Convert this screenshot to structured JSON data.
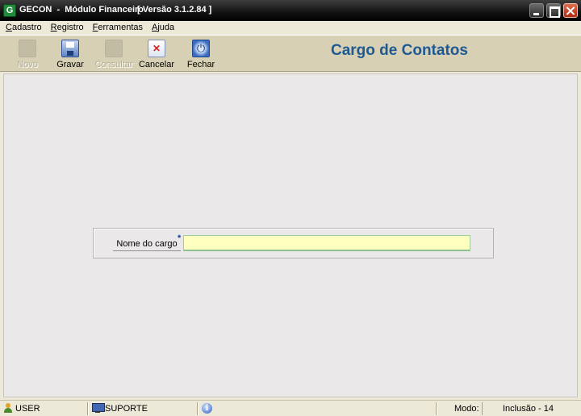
{
  "window": {
    "app_icon_letter": "G",
    "title": "GECON  -  Módulo Financeiro",
    "version": "[ Versão 3.1.2.84 ]"
  },
  "menu": [
    {
      "mnemonic": "C",
      "rest": "adastro"
    },
    {
      "mnemonic": "R",
      "rest": "egistro"
    },
    {
      "mnemonic": "F",
      "rest": "erramentas"
    },
    {
      "mnemonic": "A",
      "rest": "juda"
    }
  ],
  "toolbar": {
    "novo": {
      "label": "Novo",
      "icon": "new-icon",
      "enabled": false
    },
    "gravar": {
      "label": "Gravar",
      "icon": "save-icon",
      "enabled": true
    },
    "consultar": {
      "label": "Consultar",
      "icon": "search-icon",
      "enabled": false
    },
    "cancelar": {
      "label": "Cancelar",
      "icon": "cancel-icon",
      "enabled": true
    },
    "fechar": {
      "label": "Fechar",
      "icon": "power-icon",
      "enabled": true
    }
  },
  "screen_title": "Cargo de Contatos",
  "form": {
    "label": "Nome do cargo",
    "required_mark": "*",
    "value": ""
  },
  "statusbar": {
    "user": "USER",
    "station": "SUPORTE",
    "mode_label": "Modo:",
    "mode_value": "Inclusão - 14"
  },
  "colors": {
    "title_accent": "#1d5a93",
    "input_background": "#ffffc0",
    "close_button": "#c8401f"
  }
}
